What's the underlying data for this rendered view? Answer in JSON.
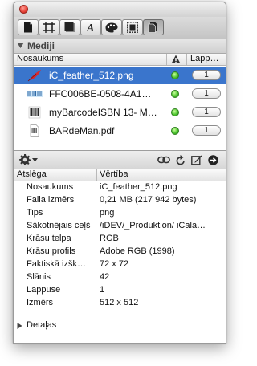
{
  "toolbar": {
    "tabs": [
      {
        "name": "document-icon"
      },
      {
        "name": "crop-frame-icon"
      },
      {
        "name": "shadow-box-icon"
      },
      {
        "name": "text-icon"
      },
      {
        "name": "palette-icon"
      },
      {
        "name": "image-frame-icon"
      },
      {
        "name": "media-icon",
        "active": true
      }
    ]
  },
  "media_section": {
    "title": "Mediji",
    "columns": {
      "name": "Nosaukums",
      "status_icon": "warning-icon",
      "pages": "Lapp…"
    },
    "items": [
      {
        "name": "iC_feather_512.png",
        "page": "1",
        "status": "green",
        "icon": "feather-icon",
        "selected": true
      },
      {
        "name": "FFC006BE-0508-4A1…",
        "page": "1",
        "status": "green",
        "icon": "barcode-icon",
        "selected": false
      },
      {
        "name": "myBarcodeISBN 13- M…",
        "page": "1",
        "status": "green",
        "icon": "barcode-isbn-icon",
        "selected": false
      },
      {
        "name": "BARdeMan.pdf",
        "page": "1",
        "status": "green",
        "icon": "pdf-file-icon",
        "selected": false
      }
    ]
  },
  "action_bar": {
    "icons": [
      "gear-icon",
      "chevron-down-icon",
      "link-icon",
      "refresh-icon",
      "edit-icon",
      "go-arrow-icon"
    ]
  },
  "properties": {
    "columns": {
      "key": "Atslēga",
      "value": "Vērtība"
    },
    "rows": [
      {
        "key": "Nosaukums",
        "value": "iC_feather_512.png"
      },
      {
        "key": "Faila izmērs",
        "value": "0,21 MB (217 942 bytes)"
      },
      {
        "key": "Tips",
        "value": "png"
      },
      {
        "key": "Sākotnējais ceļš",
        "value": "/iDEV/_Produktion/ iCala…"
      },
      {
        "key": "Krāsu telpa",
        "value": "RGB"
      },
      {
        "key": "Krāsu profils",
        "value": "Adobe RGB (1998)"
      },
      {
        "key": "Faktiskā izšķ…",
        "value": "72 x 72"
      },
      {
        "key": "Slānis",
        "value": "42"
      },
      {
        "key": "Lappuse",
        "value": "1"
      },
      {
        "key": "Izmērs",
        "value": "512 x 512"
      }
    ],
    "details_label": "Detaļas"
  },
  "colors": {
    "selection": "#3a75cc",
    "status_green": "#4cc52d",
    "close_red": "#e9463c"
  }
}
